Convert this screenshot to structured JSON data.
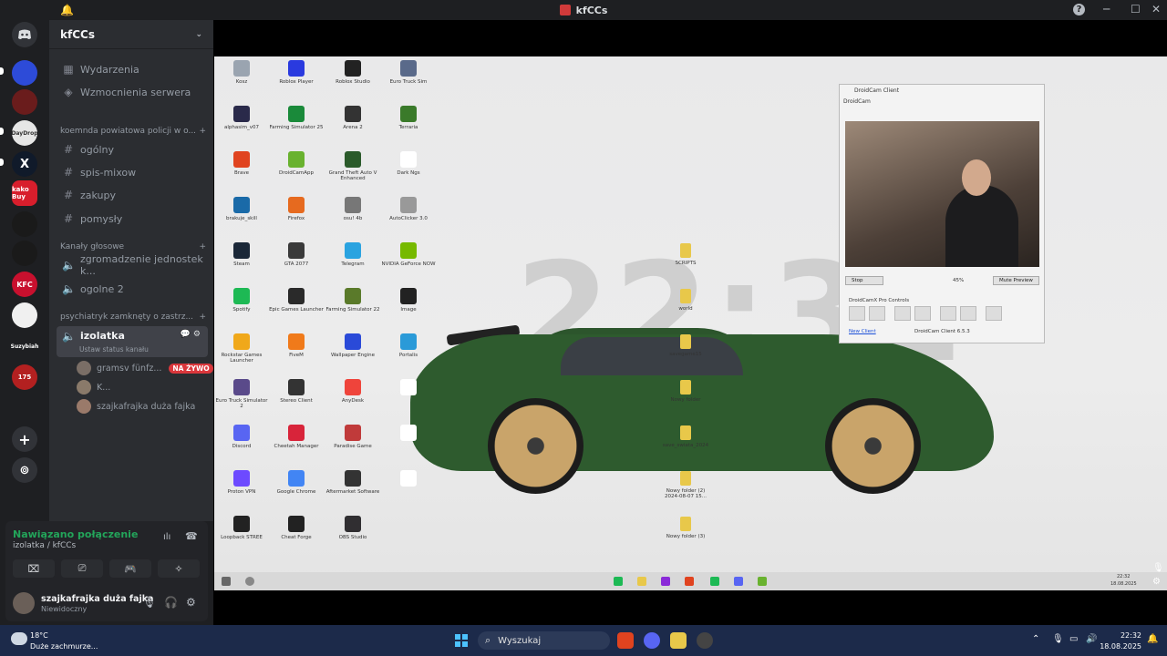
{
  "window": {
    "title": "kfCCs"
  },
  "servers": {
    "items": [
      {
        "label": "",
        "color": "#5865f2"
      },
      {
        "label": "",
        "color": "#2d4bd8"
      },
      {
        "label": "",
        "color": "#6a1c1c"
      },
      {
        "label": "DayDrop",
        "color": "#e6e6e6"
      },
      {
        "label": "X",
        "color": "#101a2a"
      },
      {
        "label": "kako Buy",
        "color": "#d81e2c"
      },
      {
        "label": "",
        "color": "#1a1a1a"
      },
      {
        "label": "",
        "color": "#1a1a1a"
      },
      {
        "label": "KFC",
        "color": "#c8102e"
      },
      {
        "label": "",
        "color": "#f0f0f0"
      },
      {
        "label": "Suzybiah",
        "color": "#1e1f22"
      },
      {
        "label": "175",
        "color": "#b32020"
      }
    ]
  },
  "guild": {
    "name": "kfCCs"
  },
  "sidebar": {
    "top": [
      {
        "label": "Wydarzenia"
      },
      {
        "label": "Wzmocnienia serwera"
      }
    ],
    "category1": "koemnda powiatowa policji w o...",
    "text_channels": [
      {
        "label": "ogólny"
      },
      {
        "label": "spis-mixow"
      },
      {
        "label": "zakupy"
      },
      {
        "label": "pomysły"
      }
    ],
    "category2": "Kanały głosowe",
    "voice_channels": [
      {
        "label": "zgromadzenie jednostek k..."
      },
      {
        "label": "ogolne 2"
      }
    ],
    "category3": "psychiatryk zamknęty o zastrz...",
    "active_channel": {
      "label": "izolatka",
      "status": "Ustaw status kanału"
    },
    "voice_users": [
      {
        "name": "gramsv fünfz...",
        "badge": "NA ŻYWO"
      },
      {
        "name": "K...",
        "badge": ""
      },
      {
        "name": "szajkafrajka duża fajka",
        "badge": ""
      }
    ]
  },
  "user_panel": {
    "connection": "Nawiązano połączenie",
    "connection_sub": "izolatka / kfCCs",
    "username": "szajkafrajka duża fajka",
    "status": "Niewidoczny"
  },
  "stream": {
    "clock": "22:32",
    "desktop_icons": [
      {
        "label": "Kosz",
        "color": "#9aa4b0"
      },
      {
        "label": "Roblox Player",
        "color": "#2a3adf"
      },
      {
        "label": "Roblox Studio",
        "color": "#222"
      },
      {
        "label": "Euro Truck Sim",
        "color": "#5a6a8a"
      },
      {
        "label": "alphasim_v07",
        "color": "#2a2a4a"
      },
      {
        "label": "Farming Simulator 25",
        "color": "#1a8a3a"
      },
      {
        "label": "Arena 2",
        "color": "#333"
      },
      {
        "label": "Terraria",
        "color": "#3a7a2a"
      },
      {
        "label": "Brave",
        "color": "#e0431f"
      },
      {
        "label": "DroidCamApp",
        "color": "#69b22f"
      },
      {
        "label": "Grand Theft Auto V Enhanced",
        "color": "#2a5a2a"
      },
      {
        "label": "Dark Ngs",
        "color": "#fff"
      },
      {
        "label": "brakuje_skill",
        "color": "#1a6aa8"
      },
      {
        "label": "Firefox",
        "color": "#e66a1f"
      },
      {
        "label": "osu! 4b",
        "color": "#777"
      },
      {
        "label": "AutoClicker 3.0",
        "color": "#999"
      },
      {
        "label": "Steam",
        "color": "#1b2838"
      },
      {
        "label": "GTA 2077",
        "color": "#3a3a3a"
      },
      {
        "label": "Telegram",
        "color": "#2aa3e0"
      },
      {
        "label": "NVIDIA GeForce NOW",
        "color": "#76b900"
      },
      {
        "label": "Spotify",
        "color": "#1db954"
      },
      {
        "label": "Epic Games Launcher",
        "color": "#2a2a2a"
      },
      {
        "label": "Farming Simulator 22",
        "color": "#5a7a2a"
      },
      {
        "label": "Image",
        "color": "#222"
      },
      {
        "label": "Rockstar Games Launcher",
        "color": "#f0a81a"
      },
      {
        "label": "FiveM",
        "color": "#f07a1a"
      },
      {
        "label": "Wallpaper Engine",
        "color": "#2a4ad8"
      },
      {
        "label": "Portalis",
        "color": "#2a9ad8"
      },
      {
        "label": "Euro Truck Simulator 2",
        "color": "#5a4a8a"
      },
      {
        "label": "Stereo Client",
        "color": "#333"
      },
      {
        "label": "AnyDesk",
        "color": "#ef443b"
      },
      {
        "label": "",
        "color": "#fff"
      },
      {
        "label": "Discord",
        "color": "#5865f2"
      },
      {
        "label": "Cheetah Manager",
        "color": "#d8243a"
      },
      {
        "label": "Paradise Game",
        "color": "#c03a3a"
      },
      {
        "label": "",
        "color": "#fff"
      },
      {
        "label": "Proton VPN",
        "color": "#6d4aff"
      },
      {
        "label": "Google Chrome",
        "color": "#4285f4"
      },
      {
        "label": "Aftermarket Software",
        "color": "#333"
      },
      {
        "label": "",
        "color": "#fff"
      },
      {
        "label": "Loopback STREE",
        "color": "#222"
      },
      {
        "label": "Cheat Forge",
        "color": "#222"
      },
      {
        "label": "OBS Studio",
        "color": "#302e31"
      }
    ],
    "folders": [
      {
        "label": "SCRIPTS"
      },
      {
        "label": "world"
      },
      {
        "label": "savegame15"
      },
      {
        "label": "Nowy folder"
      },
      {
        "label": "save_swiata_2024"
      },
      {
        "label": "Nowy folder (2) 2024-08-07 15..."
      },
      {
        "label": "Nowy folder (3)"
      }
    ],
    "droidcam": {
      "title": "DroidCam Client",
      "menu": "DroidCam",
      "stop": "Stop",
      "battery": "45%",
      "mute": "Mute Preview",
      "controls": "DroidCamX Pro Controls",
      "new_client": "New Client",
      "version": "DroidCam Client 6.5.3"
    },
    "inner_clock": "22:32",
    "inner_date": "18.08.2025"
  },
  "taskbar": {
    "temp": "18°C",
    "weather": "Duże zachmurze...",
    "search": "Wyszukaj",
    "time": "22:32",
    "date": "18.08.2025"
  }
}
